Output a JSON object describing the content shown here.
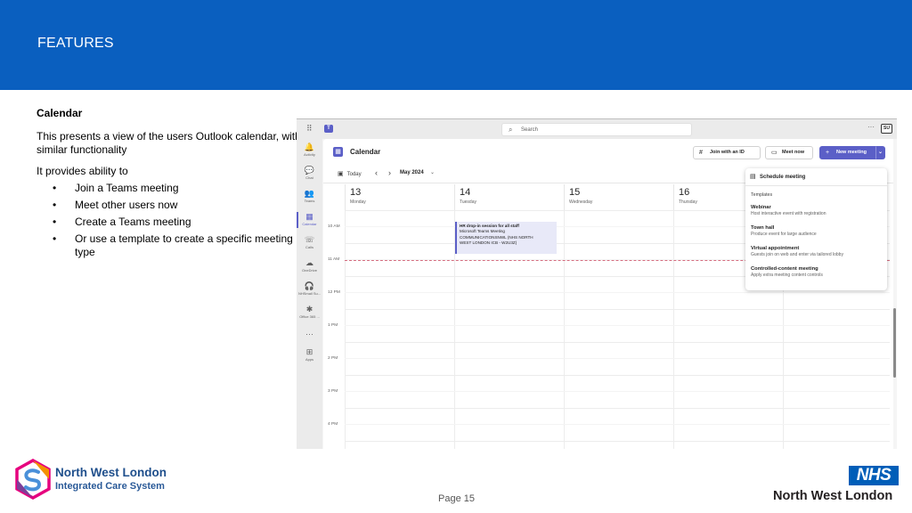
{
  "slide": {
    "title": "FEATURES",
    "page_label": "Page 15"
  },
  "intro": {
    "heading": "Calendar",
    "description": "This presents a view of the users Outlook calendar, with similar functionality",
    "lead": "It provides ability to",
    "bullet_char": "•",
    "bullets": [
      "Join a Teams meeting",
      "Meet other users now",
      "Create a Teams meeting",
      "Or use a template to create a specific meeting type"
    ]
  },
  "teams": {
    "search_placeholder": "Search",
    "avatar_initials": "SU",
    "more_glyph": "···",
    "rail": [
      {
        "label": "Activity",
        "icon": "bell-icon",
        "glyph": "🔔"
      },
      {
        "label": "Chat",
        "icon": "chat-icon",
        "glyph": "💬"
      },
      {
        "label": "Teams",
        "icon": "teams-icon",
        "glyph": "👥"
      },
      {
        "label": "Calendar",
        "icon": "calendar-icon",
        "glyph": "▦"
      },
      {
        "label": "Calls",
        "icon": "phone-icon",
        "glyph": "☏"
      },
      {
        "label": "OneDrive",
        "icon": "cloud-icon",
        "glyph": "☁"
      },
      {
        "label": "NHSmail Su...",
        "icon": "headset-icon",
        "glyph": "🎧"
      },
      {
        "label": "Office 365 ...",
        "icon": "office-icon",
        "glyph": "✱"
      },
      {
        "label": "",
        "icon": "more-apps-icon",
        "glyph": "···"
      },
      {
        "label": "Apps",
        "icon": "apps-icon",
        "glyph": "⊞"
      }
    ],
    "calendar": {
      "title": "Calendar",
      "join_button": "Join with an ID",
      "meet_now_button": "Meet now",
      "new_meeting_button": "New meeting",
      "today_button": "Today",
      "month": "May 2024",
      "days": [
        {
          "num": "13",
          "name": "Monday"
        },
        {
          "num": "14",
          "name": "Tuesday"
        },
        {
          "num": "15",
          "name": "Wednesday"
        },
        {
          "num": "16",
          "name": "Thursday"
        },
        {
          "num": "",
          "name": ""
        }
      ],
      "times": [
        "10 AM",
        "11 AM",
        "12 PM",
        "1 PM",
        "2 PM",
        "3 PM",
        "4 PM"
      ],
      "event": {
        "title": "HR drop-in session for all staff",
        "subtitle": "Microsoft Teams Meeting",
        "location_1": "COMMUNICATIONSNWL (NHS NORTH",
        "location_2": "WEST LONDON ICB - W2U3Z)"
      }
    },
    "dropdown": {
      "schedule": "Schedule meeting",
      "templates_label": "Templates",
      "templates": [
        {
          "name": "Webinar",
          "desc": "Host interactive event with registration"
        },
        {
          "name": "Town hall",
          "desc": "Produce event for large audience"
        },
        {
          "name": "Virtual appointment",
          "desc": "Guests join on web and enter via tailored lobby"
        },
        {
          "name": "Controlled-content meeting",
          "desc": "Apply extra meeting content controls"
        }
      ]
    }
  },
  "footer": {
    "org_line1": "North West London",
    "org_line2": "Integrated Care System",
    "nhs_badge": "NHS",
    "nhs_name": "North West London"
  },
  "colors": {
    "header_blue": "#0a5fbf",
    "teams_purple": "#5b5fc7",
    "nhs_blue": "#005eb8",
    "now_line": "#c4314b"
  }
}
